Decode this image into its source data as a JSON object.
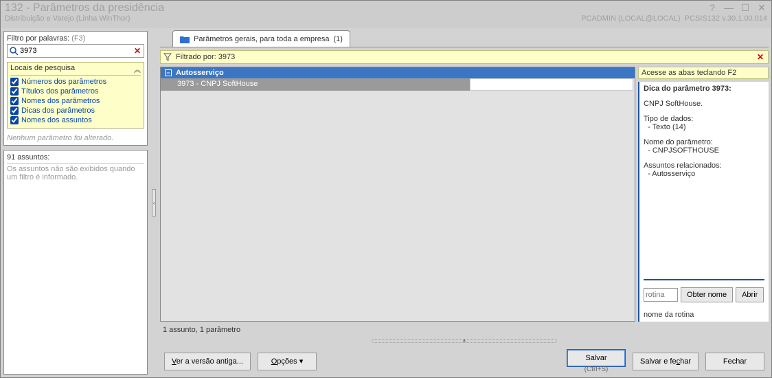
{
  "user_info": "PCADMIN (LOCAL@LOCAL)",
  "version_info": "PCSIS132  v.30.1.00.014",
  "main_tab": {
    "label": "Parâmetros gerais, para toda a empresa",
    "count": "(1)"
  },
  "window": {
    "title": "132 - Parâmetros da presidência",
    "subtitle": "Distribuição e Varejo (Linha WinThor)"
  },
  "filter": {
    "label": "Filtro por palavras:",
    "hint": "(F3)",
    "value": "3973",
    "locais_label": "Locais de pesquisa",
    "checks": [
      "Números dos parâmetros",
      "Títulos dos parâmetros",
      "Nomes dos parâmetros",
      "Dicas dos parâmetros",
      "Nomes dos assuntos"
    ],
    "note": "Nenhum parâmetro foi alterado."
  },
  "assuntos": {
    "title": "91 assuntos:",
    "msg": "Os assuntos não são exibidos quando um filtro é informado."
  },
  "filterbar": {
    "label": "Filtrado por:",
    "value": "3973"
  },
  "grid": {
    "group": "Autosserviço",
    "row": "3973 - CNPJ SoftHouse"
  },
  "side": {
    "access_hint": "Acesse as abas teclando F2",
    "head": "Dica do parâmetro 3973:",
    "desc": "CNPJ SoftHouse.",
    "tipo_label": "Tipo de dados:",
    "tipo_value": "- Texto (14)",
    "nome_label": "Nome do parâmetro:",
    "nome_value": "- CNPJSOFTHOUSE",
    "rel_label": "Assuntos relacionados:",
    "rel_value": "- Autosserviço",
    "rotina_placeholder": "rotina",
    "obter": "Obter nome",
    "abrir": "Abrir",
    "rotina_lbl": "nome da rotina"
  },
  "status": "1 assunto, 1 parâmetro",
  "buttons": {
    "versao": "Ver a versão antiga...",
    "opcoes": "Opções ▾",
    "salvar": "Salvar",
    "salvar_short": "(Ctrl+S)",
    "salvar_fechar": "Salvar e fechar",
    "fechar": "Fechar"
  }
}
